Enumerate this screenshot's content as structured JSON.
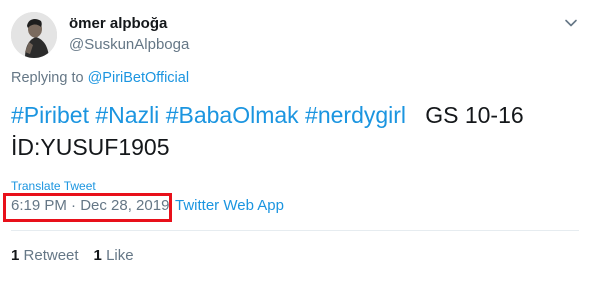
{
  "tweet": {
    "author": {
      "display_name": "ömer alpboğa",
      "handle": "@SuskunAlpboga"
    },
    "replying_to_prefix": "Replying to ",
    "replying_to_handle": "@PiriBetOfficial",
    "text": {
      "hashtags": [
        "#Piribet",
        "#Nazli",
        "#BabaOlmak",
        "#nerdygirl"
      ],
      "trailing": "GS 10-16",
      "second_line": "İD:YUSUF1905"
    },
    "translate_label": "Translate Tweet",
    "timestamp": "6:19 PM · Dec 28, 2019",
    "separator": "·",
    "source": "Twitter Web App",
    "stats": {
      "retweets_count": "1",
      "retweets_label": "Retweet",
      "likes_count": "1",
      "likes_label": "Like"
    }
  },
  "colors": {
    "link": "#1b95e0",
    "secondary_text": "#657786",
    "highlight_box": "#e8101a"
  },
  "icons": {
    "menu": "chevron-down-icon"
  }
}
